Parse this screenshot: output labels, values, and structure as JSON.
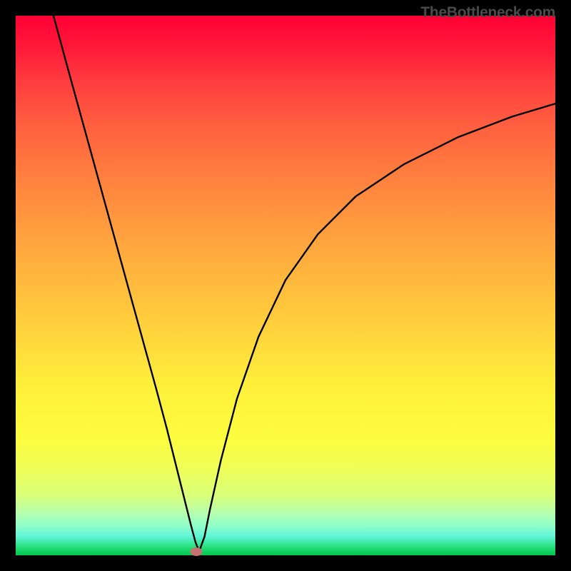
{
  "watermark": "TheBottleneck.com",
  "chart_data": {
    "type": "line",
    "title": "",
    "xlabel": "",
    "ylabel": "",
    "xlim": [
      0,
      100
    ],
    "ylim": [
      0,
      100
    ],
    "grid": false,
    "series": [
      {
        "name": "curve",
        "x": [
          7,
          10,
          14,
          18,
          22,
          26,
          28,
          30,
          31.5,
          32.5,
          33.3,
          34,
          35,
          36,
          38,
          41,
          45,
          50,
          56,
          63,
          72,
          82,
          92,
          100
        ],
        "y": [
          100,
          89,
          74.5,
          60,
          45.5,
          31,
          23.5,
          15.5,
          9.5,
          5.5,
          2.5,
          0.7,
          3.5,
          8.5,
          17.5,
          29,
          40.5,
          51,
          59.5,
          66.5,
          72.5,
          77.5,
          81.3,
          83.7
        ]
      }
    ],
    "marker": {
      "x": 33.5,
      "y": 0.7
    },
    "gradient_stops": [
      {
        "pos": 0,
        "color": "#ff0033"
      },
      {
        "pos": 50,
        "color": "#ffc33d"
      },
      {
        "pos": 80,
        "color": "#fdfd3e"
      },
      {
        "pos": 100,
        "color": "#00c84d"
      }
    ]
  }
}
